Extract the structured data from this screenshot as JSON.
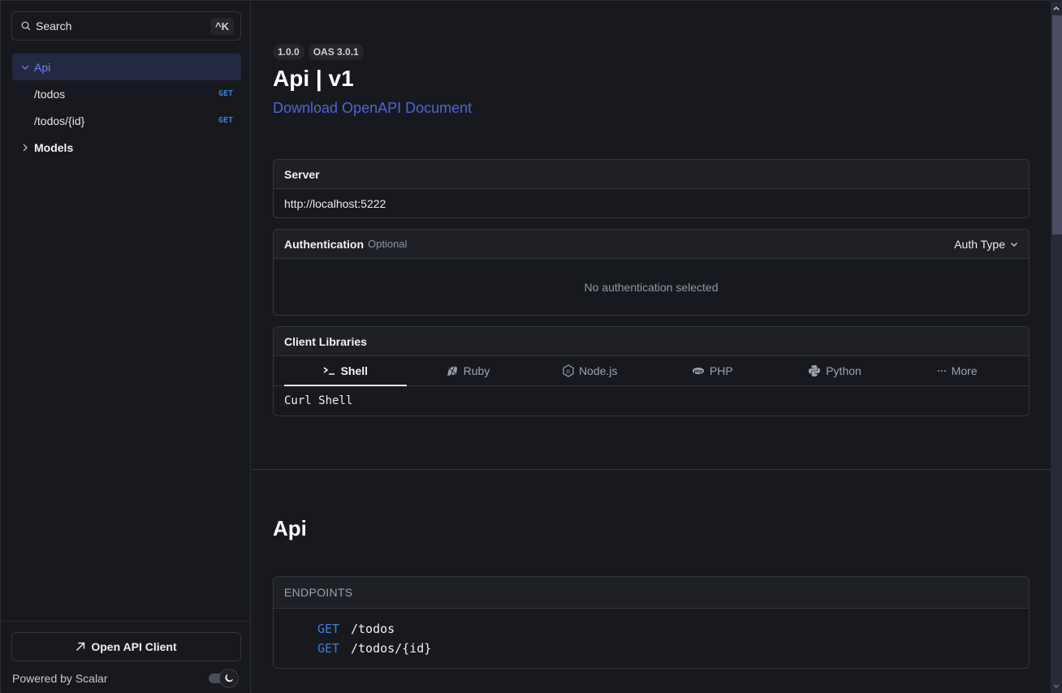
{
  "sidebar": {
    "search": {
      "label": "Search",
      "shortcut": "^K"
    },
    "nav": [
      {
        "label": "Api",
        "type": "group",
        "expanded": true,
        "active": true
      },
      {
        "label": "/todos",
        "method": "GET",
        "type": "endpoint"
      },
      {
        "label": "/todos/{id}",
        "method": "GET",
        "type": "endpoint"
      },
      {
        "label": "Models",
        "type": "group",
        "expanded": false
      }
    ],
    "open_client_label": "Open API Client",
    "powered_by": "Powered by Scalar",
    "theme": "dark"
  },
  "header": {
    "version_badge": "1.0.0",
    "oas_badge": "OAS 3.0.1",
    "title": "Api | v1",
    "download_link": "Download OpenAPI Document"
  },
  "server": {
    "heading": "Server",
    "url": "http://localhost:5222"
  },
  "authentication": {
    "heading": "Authentication",
    "optional_label": "Optional",
    "auth_type_label": "Auth Type",
    "empty_message": "No authentication selected"
  },
  "client_libraries": {
    "heading": "Client Libraries",
    "tabs": [
      {
        "label": "Shell",
        "icon": "terminal-icon",
        "active": true
      },
      {
        "label": "Ruby",
        "icon": "ruby-icon"
      },
      {
        "label": "Node.js",
        "icon": "nodejs-icon"
      },
      {
        "label": "PHP",
        "icon": "php-icon"
      },
      {
        "label": "Python",
        "icon": "python-icon"
      },
      {
        "label": "More",
        "icon": "ellipsis-icon"
      }
    ],
    "selected_client": "Curl Shell"
  },
  "api_section": {
    "title": "Api",
    "endpoints_heading": "ENDPOINTS",
    "endpoints": [
      {
        "method": "GET",
        "path": "/todos"
      },
      {
        "method": "GET",
        "path": "/todos/{id}"
      }
    ]
  },
  "colors": {
    "accent": "#7183f2",
    "link": "#4e64d6",
    "get_method": "#3d7dd8",
    "background": "#18191e"
  }
}
